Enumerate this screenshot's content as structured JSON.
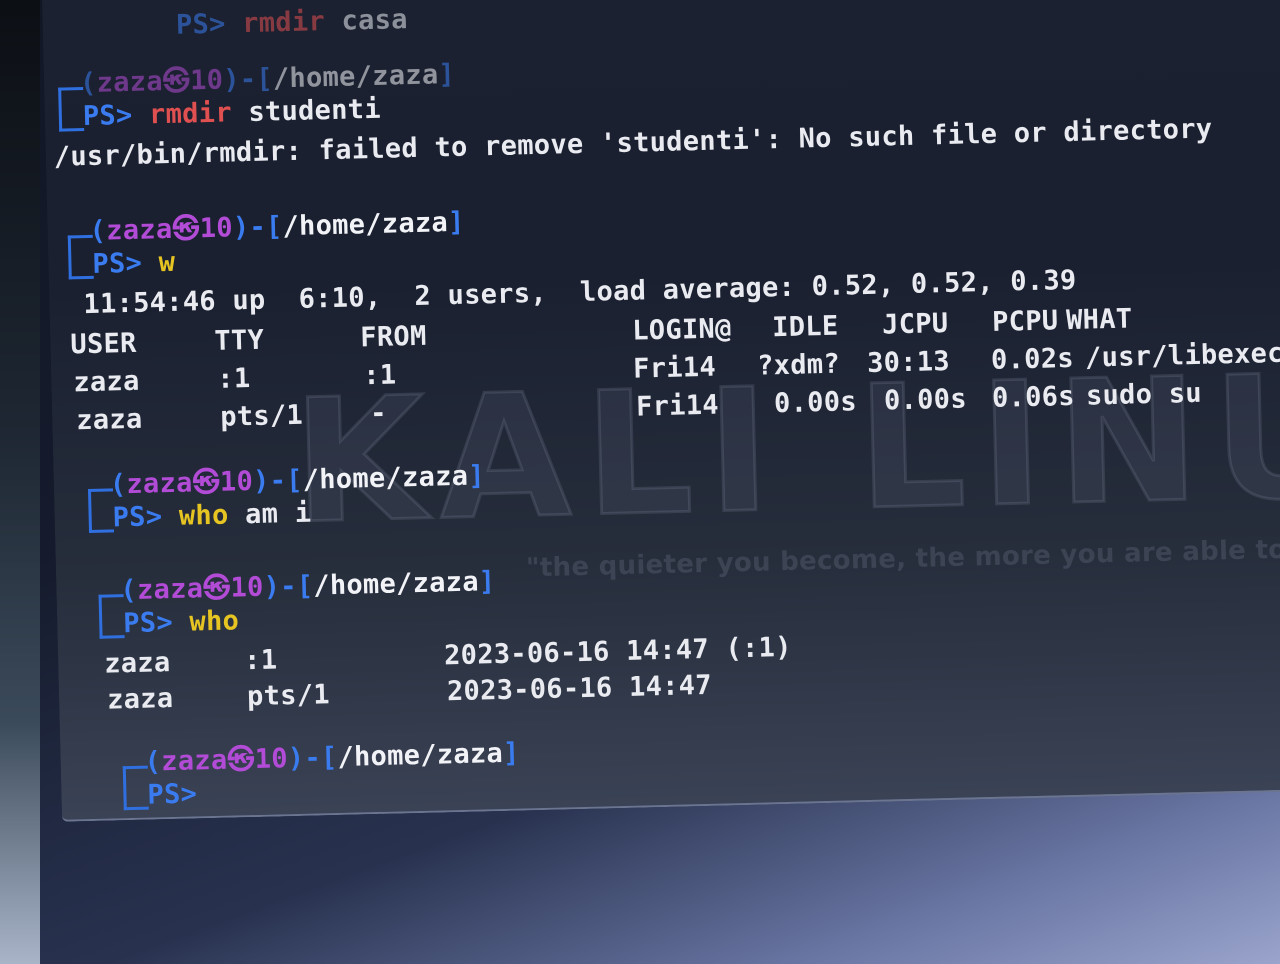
{
  "history": {
    "prev_ps": "PS>",
    "prev_cmd": "rmdir",
    "prev_arg": "casa"
  },
  "prompt": {
    "user": "zaza",
    "at_symbol": "㉿",
    "host": "10",
    "path": "/home/zaza",
    "ps": "PS>"
  },
  "block1": {
    "cmd": "rmdir",
    "arg": "studenti",
    "output": "/usr/bin/rmdir: failed to remove 'studenti': No such file or directory"
  },
  "block2": {
    "cmd": "w",
    "summary": "11:54:46 up  6:10,  2 users,  load average: 0.52, 0.52, 0.39",
    "headers": [
      "USER",
      "TTY",
      "FROM",
      "LOGIN@",
      "IDLE",
      "JCPU",
      "PCPU",
      "WHAT"
    ],
    "rows": [
      [
        "zaza",
        ":1",
        ":1",
        "Fri14",
        "?xdm?",
        "30:13",
        "0.02s",
        "/usr/libexec/g"
      ],
      [
        "zaza",
        "pts/1",
        "-",
        "Fri14",
        "0.00s",
        "0.00s",
        "0.06s",
        "sudo su"
      ]
    ]
  },
  "block3": {
    "cmd": "who",
    "args": "am i"
  },
  "block4": {
    "cmd": "who",
    "rows": [
      [
        "zaza",
        ":1",
        "2023-06-16 14:47 (:1)"
      ],
      [
        "zaza",
        "pts/1",
        "2023-06-16 14:47"
      ]
    ]
  },
  "background": {
    "watermark": "KALI LINUX",
    "quote": "\"the quieter you become, the more you are able to hear\""
  },
  "colors": {
    "prompt_frame": "#3a7cf0",
    "user_host": "#b24bd6",
    "command_rmdir": "#e05050",
    "command_who": "#e6c422"
  }
}
